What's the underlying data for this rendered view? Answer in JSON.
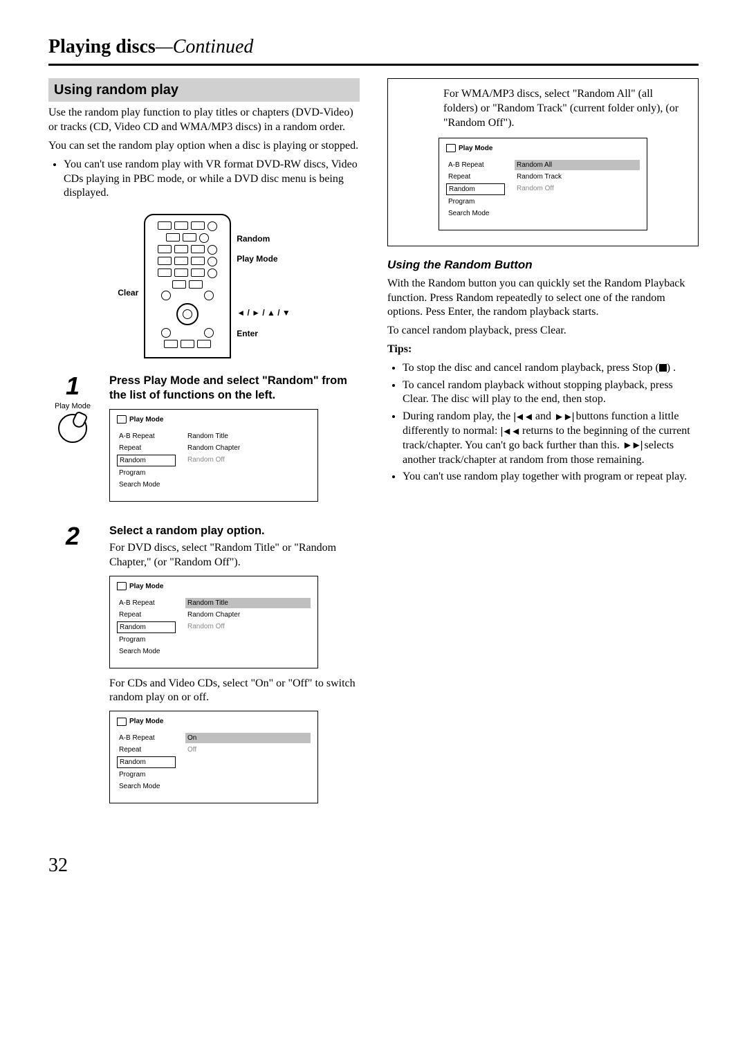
{
  "header": {
    "title": "Playing discs",
    "continued": "—Continued"
  },
  "left": {
    "section_heading": "Using random play",
    "intro1": "Use the random play function to play titles or chapters (DVD-Video) or tracks (CD, Video CD and WMA/MP3 discs) in a random order.",
    "intro2": "You can set the random play option when a disc is playing or stopped.",
    "bullet1": "You can't use random play with VR format DVD-RW discs, Video CDs playing in PBC mode, or while a DVD disc menu is being displayed.",
    "remote": {
      "left_label": "Clear",
      "right_labels": {
        "random": "Random",
        "playmode": "Play Mode",
        "arrows": "◄ / ► / ▲ / ▼",
        "enter": "Enter"
      }
    },
    "step1": {
      "num": "1",
      "sub": "Play Mode",
      "head": "Press Play Mode and select \"Random\" from the list of functions on the left.",
      "osd": {
        "title": "Play Mode",
        "left": [
          "A-B Repeat",
          "Repeat",
          "Random",
          "Program",
          "Search Mode"
        ],
        "right": [
          "Random Title",
          "Random Chapter",
          "Random Off"
        ]
      }
    },
    "step2": {
      "num": "2",
      "head": "Select a random play option.",
      "dvd_text": "For DVD discs, select \"Random Title\" or \"Random Chapter,\" (or \"Random Off\").",
      "osd_dvd": {
        "title": "Play Mode",
        "left": [
          "A-B Repeat",
          "Repeat",
          "Random",
          "Program",
          "Search Mode"
        ],
        "right": [
          "Random Title",
          "Random Chapter",
          "Random Off"
        ]
      },
      "cd_text": "For CDs and Video CDs, select \"On\" or \"Off\" to switch random play on or off.",
      "osd_cd": {
        "title": "Play Mode",
        "left": [
          "A-B Repeat",
          "Repeat",
          "Random",
          "Program",
          "Search Mode"
        ],
        "right": [
          "On",
          "Off"
        ]
      }
    }
  },
  "right": {
    "wma_text": "For WMA/MP3 discs, select \"Random All\" (all folders) or \"Random Track\" (current folder only), (or \"Random Off\").",
    "osd_wma": {
      "title": "Play Mode",
      "left": [
        "A-B Repeat",
        "Repeat",
        "Random",
        "Program",
        "Search Mode"
      ],
      "right": [
        "Random All",
        "Random Track",
        "Random Off"
      ]
    },
    "sub_heading": "Using the Random Button",
    "para1": "With the Random button you can quickly set the Random Playback function. Press Random repeatedly to select one of the random options. Pess Enter, the random playback starts.",
    "para2": "To cancel random playback, press Clear.",
    "tips_label": "Tips:",
    "tips": {
      "t1a": "To stop the disc and cancel random playback, press Stop (",
      "t1b": ") .",
      "t2": "To cancel random playback without stopping playback, press Clear. The disc will play to the end, then stop.",
      "t3a": "During random play, the ",
      "t3b": " and ",
      "t3c": " buttons function a little differently to normal: ",
      "t3d": " returns to the beginning of the current track/chapter. You can't go back further than this. ",
      "t3e": " selects another track/chapter at random from those remaining.",
      "t4": "You can't use random play together with program or repeat play."
    }
  },
  "page_number": "32"
}
